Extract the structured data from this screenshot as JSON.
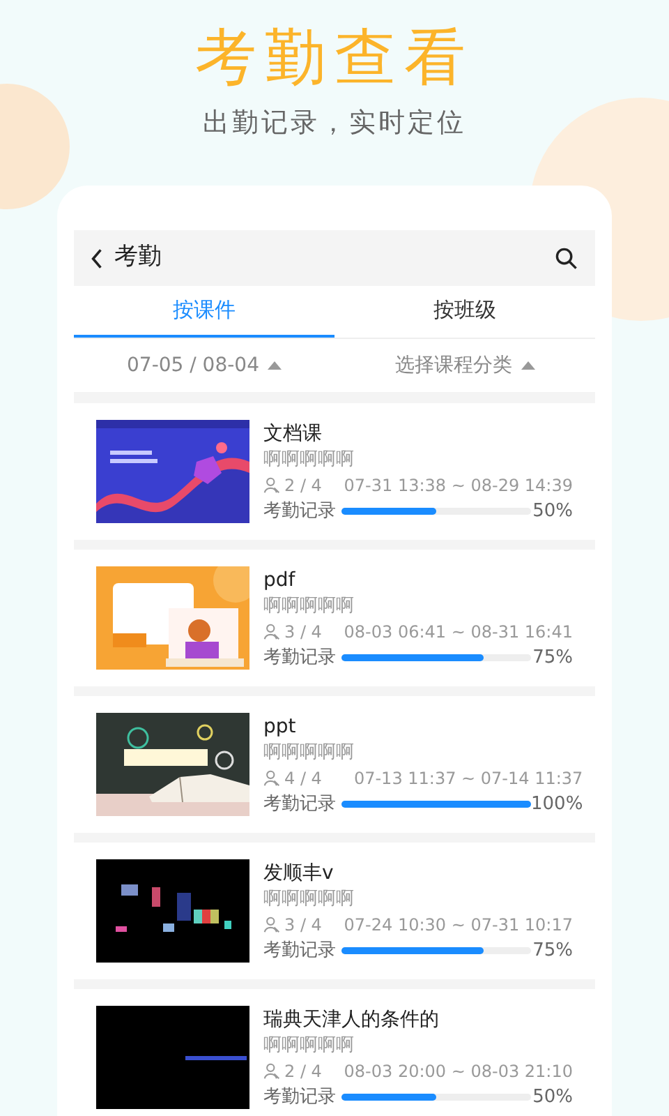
{
  "banner": {
    "title": "考勤查看",
    "subtitle": "出勤记录，实时定位"
  },
  "app": {
    "header": {
      "title": "考勤"
    },
    "tabs": [
      {
        "label": "按课件",
        "selected": true
      },
      {
        "label": "按班级",
        "selected": false
      }
    ],
    "filters": [
      {
        "label": "07-05 / 08-04"
      },
      {
        "label": "选择课程分类"
      }
    ],
    "courses": [
      {
        "title": "文档课",
        "subtitle": "啊啊啊啊啊",
        "attendance": "2 / 4",
        "time": "07-31 13:38 ~ 08-29 14:39",
        "record_label": "考勤记录",
        "level": 0.5,
        "percent": "50%"
      },
      {
        "title": "pdf",
        "subtitle": "啊啊啊啊啊",
        "attendance": "3 / 4",
        "time": "08-03 06:41 ~ 08-31 16:41",
        "record_label": "考勤记录",
        "level": 0.75,
        "percent": "75%"
      },
      {
        "title": "ppt",
        "subtitle": "啊啊啊啊啊",
        "attendance": "4 / 4",
        "time": "07-13 11:37 ~ 07-14 11:37",
        "record_label": "考勤记录",
        "level": 1,
        "percent": "100%"
      },
      {
        "title": "发顺丰v",
        "subtitle": "啊啊啊啊啊",
        "attendance": "3 / 4",
        "time": "07-24 10:30 ~ 07-31 10:17",
        "record_label": "考勤记录",
        "level": 0.75,
        "percent": "75%"
      },
      {
        "title": "瑞典天津人的条件的",
        "subtitle": "啊啊啊啊啊",
        "attendance": "2 / 4",
        "time": "08-03 20:00 ~ 08-03 21:10",
        "record_label": "考勤记录",
        "level": 0.5,
        "percent": "50%"
      }
    ]
  }
}
